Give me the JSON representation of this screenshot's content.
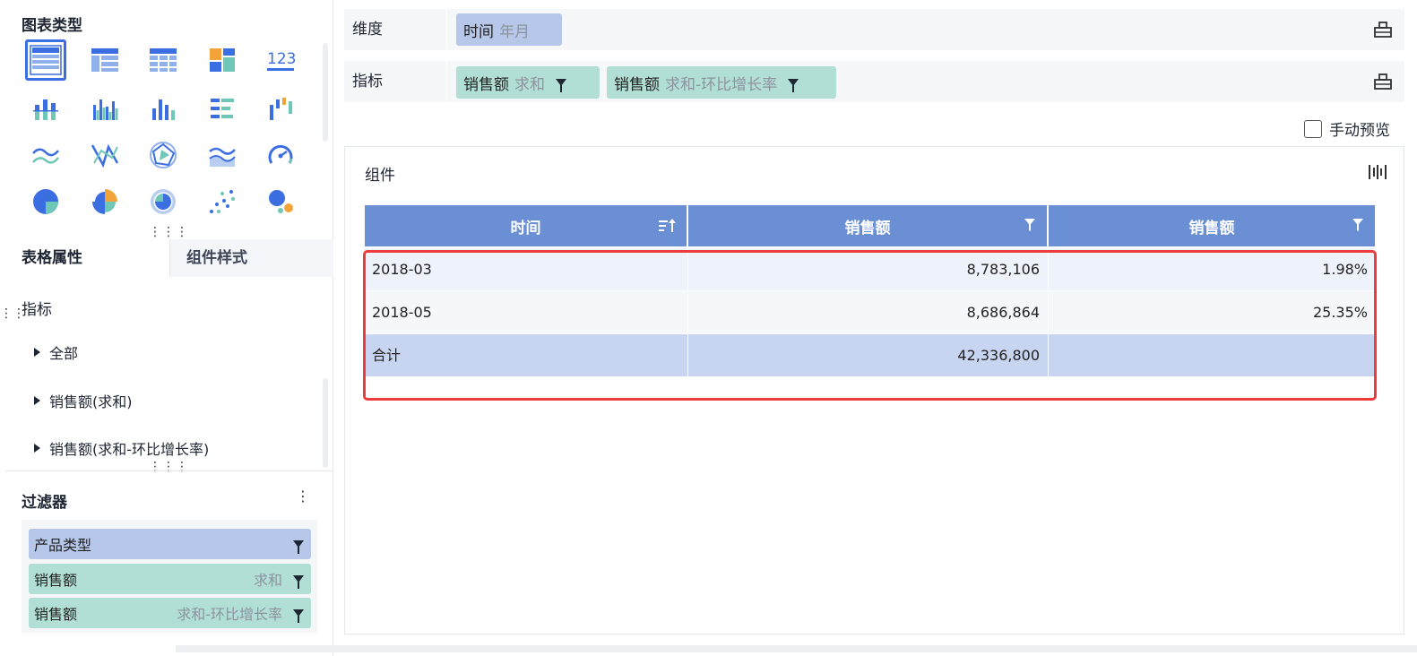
{
  "left": {
    "chart_types_title": "图表类型",
    "chart_types": [
      {
        "icon": "table-detail-icon",
        "selected": true
      },
      {
        "icon": "table-group-icon"
      },
      {
        "icon": "table-cross-icon"
      },
      {
        "icon": "table-card-icon"
      },
      {
        "icon": "kpi-number-icon",
        "text": "123"
      },
      {
        "icon": "stacked-bar-icon"
      },
      {
        "icon": "grouped-bar-icon"
      },
      {
        "icon": "column-chart-icon"
      },
      {
        "icon": "horizontal-bar-icon"
      },
      {
        "icon": "waterfall-icon"
      },
      {
        "icon": "line-chart-icon"
      },
      {
        "icon": "radar-lines-icon"
      },
      {
        "icon": "radar-chart-icon"
      },
      {
        "icon": "area-chart-icon"
      },
      {
        "icon": "gauge-icon"
      },
      {
        "icon": "pie-chart-icon"
      },
      {
        "icon": "rose-chart-icon"
      },
      {
        "icon": "donut-chart-icon"
      },
      {
        "icon": "scatter-chart-icon"
      },
      {
        "icon": "bubble-chart-icon"
      }
    ],
    "tabs": {
      "table_props": "表格属性",
      "widget_style": "组件样式"
    },
    "metrics_label": "指标",
    "tree": [
      "全部",
      "销售额(求和)",
      "销售额(求和-环比增长率)"
    ],
    "filter_title": "过滤器",
    "filters": [
      {
        "name": "产品类型",
        "agg": "",
        "kind": "dimension"
      },
      {
        "name": "销售额",
        "agg": "求和",
        "kind": "measure"
      },
      {
        "name": "销售额",
        "agg": "求和-环比增长率",
        "kind": "measure"
      }
    ]
  },
  "right": {
    "dimension_label": "维度",
    "dimension_chip": {
      "name": "时间",
      "agg": "年月"
    },
    "metric_label": "指标",
    "metric_chips": [
      {
        "name": "销售额",
        "agg": "求和"
      },
      {
        "name": "销售额",
        "agg": "求和-环比增长率"
      }
    ],
    "manual_preview": "手动预览",
    "widget_title": "组件",
    "table": {
      "columns": [
        "时间",
        "销售额",
        "销售额"
      ],
      "rows": [
        {
          "time": "2018-03",
          "sales": "8,783,106",
          "growth": "1.98%"
        },
        {
          "time": "2018-05",
          "sales": "8,686,864",
          "growth": "25.35%"
        }
      ],
      "total": {
        "label": "合计",
        "sales": "42,336,800",
        "growth": ""
      }
    }
  },
  "colors": {
    "accent": "#3b6ee0",
    "header": "#6a8fd4",
    "dim_chip": "#b6c7e9",
    "measure_chip": "#b1dfd6",
    "highlight": "#ee3b3b"
  }
}
